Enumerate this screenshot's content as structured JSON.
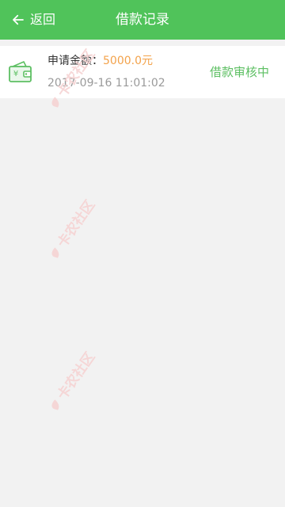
{
  "header": {
    "back_label": "返回",
    "title": "借款记录",
    "background_color": "#50c35a"
  },
  "icons": {
    "back": "arrow-left-icon",
    "wallet": "wallet-icon",
    "watermark_logo": "leaf-logo-icon"
  },
  "record": {
    "amount_label": "申请金额：",
    "amount_value": "5000.0元",
    "date": "2017-09-16 11:01:02",
    "status": "借款审核中",
    "amount_color": "#f3a24a",
    "status_color": "#5cbf62"
  },
  "watermark": {
    "text": "卡农社区"
  }
}
